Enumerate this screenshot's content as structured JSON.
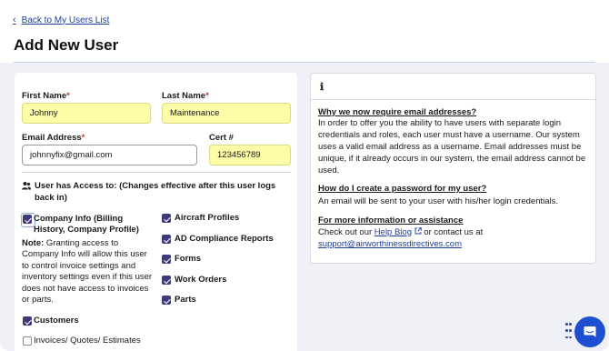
{
  "nav": {
    "back_label": "Back to My Users List"
  },
  "page": {
    "title": "Add New User"
  },
  "form": {
    "first_name": {
      "label": "First Name",
      "value": "Johnny"
    },
    "last_name": {
      "label": "Last Name",
      "value": "Maintenance"
    },
    "email": {
      "label": "Email Address",
      "value": "johnnyfix@gmail.com"
    },
    "cert": {
      "label": "Cert #",
      "value": "123456789"
    },
    "required_mark": "*"
  },
  "access": {
    "heading": "User has Access to: (Changes effective after this user logs back in)",
    "left_items": [
      {
        "label": "Company Info (Billing History, Company Profile)",
        "checked": true
      },
      {
        "label": "Customers",
        "checked": true
      },
      {
        "label": "Invoices/ Quotes/ Estimates",
        "checked": false
      }
    ],
    "right_items": [
      {
        "label": "Aircraft Profiles",
        "checked": true
      },
      {
        "label": "AD Compliance Reports",
        "checked": true
      },
      {
        "label": "Forms",
        "checked": true
      },
      {
        "label": "Work Orders",
        "checked": true
      },
      {
        "label": "Parts",
        "checked": true
      }
    ],
    "note_label": "Note:",
    "note_text": " Granting access to Company Info will allow this user to control invoice settings and inventory settings even if this user does not have access to invoices or parts."
  },
  "info": {
    "icon": "info-icon",
    "q1": "Why we now require email addresses?",
    "a1": "In order to offer you the ability to have users with separate login credentials and roles, each user must have a username. Our system uses a valid email address as a username. Email addresses must be unique, if it already occurs in our system, the email address cannot be used.",
    "q2": "How do I create a password for my user?",
    "a2": "An email will be sent to your user with his/her login credentials.",
    "q3": "For more information or assistance",
    "a3_pre": "Check out our ",
    "a3_link": "Help Blog",
    "a3_mid": " or contact us at",
    "a3_email": "support@airworthinessdirectives.com"
  },
  "colors": {
    "accent": "#1f3f95",
    "required": "#c0392b",
    "checkbox": "#3d3a7a",
    "input_highlight": "#fdfca8",
    "chat_button": "#1e4fd0"
  }
}
